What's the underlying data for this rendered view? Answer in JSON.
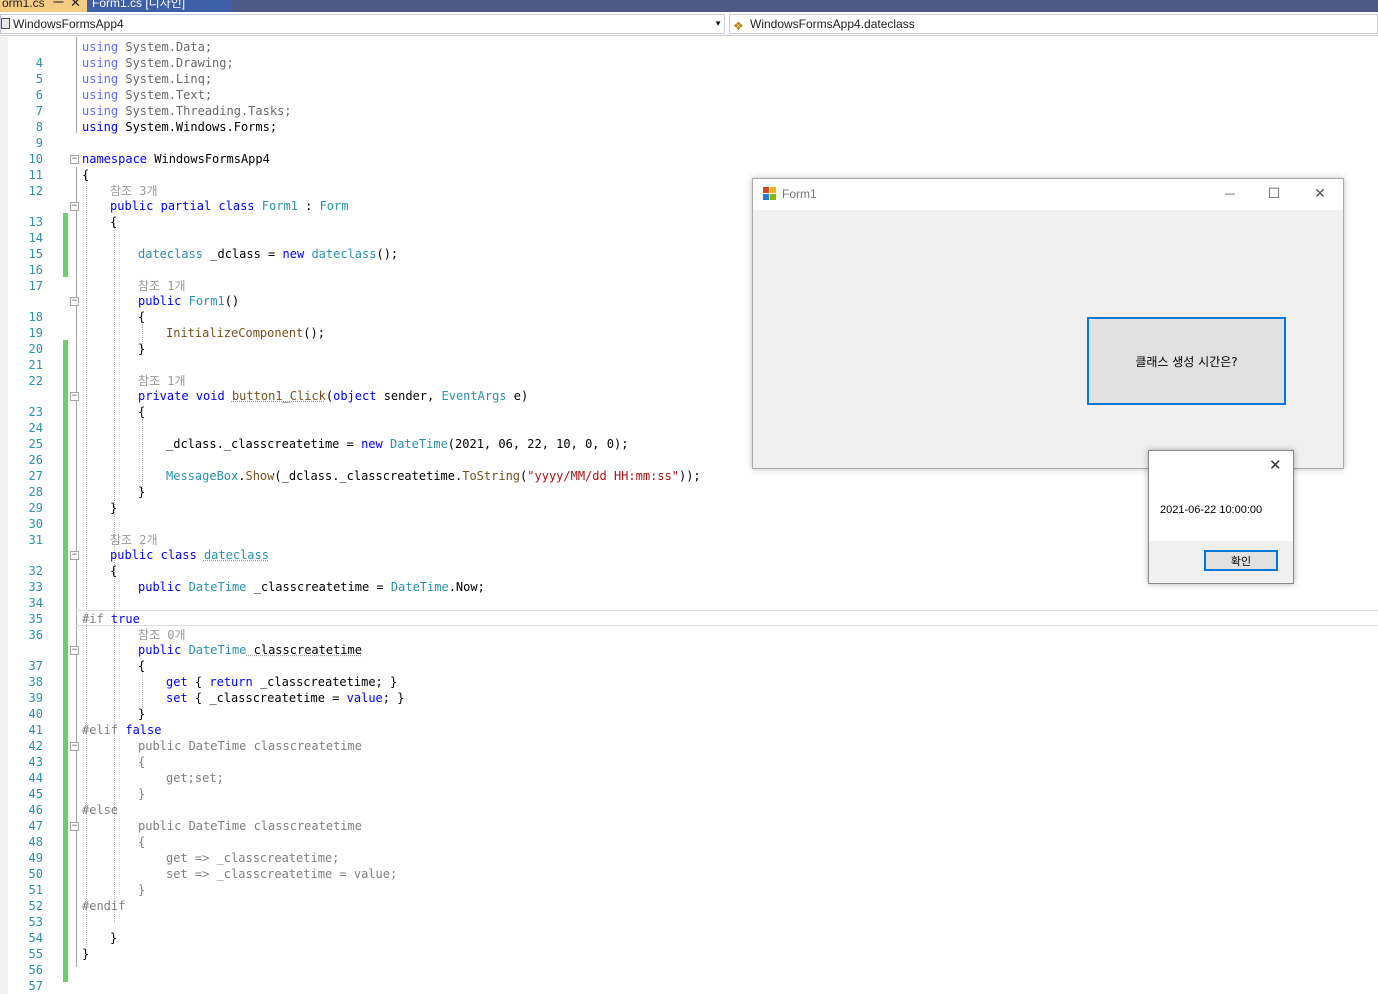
{
  "tabs": {
    "active": "orm1.cs",
    "active_pin": "㆒",
    "active_close": "✕",
    "inactive": "Form1.cs [디자인]"
  },
  "navbar": {
    "project": "WindowsFormsApp4",
    "member": "WindowsFormsApp4.dateclass"
  },
  "code": {
    "refs": {
      "r3": "참조 3개",
      "r1": "참조 1개",
      "r2": "참조 2개",
      "r0": "참조 0개"
    },
    "ln": [
      "4",
      "5",
      "6",
      "7",
      "8",
      "9",
      "10",
      "11",
      "12",
      "13",
      "14",
      "15",
      "16",
      "17",
      "18",
      "19",
      "20",
      "21",
      "22",
      "23",
      "24",
      "25",
      "26",
      "27",
      "28",
      "29",
      "30",
      "31",
      "32",
      "33",
      "34",
      "35",
      "36",
      "37",
      "38",
      "39",
      "40",
      "41",
      "42",
      "43",
      "44",
      "45",
      "46",
      "47",
      "48",
      "49",
      "50",
      "51",
      "52",
      "53",
      "54",
      "55",
      "56",
      "57"
    ],
    "t": {
      "using": "using",
      "ns_data": " System.Data;",
      "ns_drawing": " System.Drawing;",
      "ns_linq": " System.Linq;",
      "ns_text": " System.Text;",
      "ns_tasks": " System.Threading.Tasks;",
      "ns_forms": " System.Windows.Forms;",
      "namespace": "namespace",
      "ns_name": " WindowsFormsApp4",
      "open_brace": "{",
      "close_brace": "}",
      "public": "public",
      "partial": "partial",
      "class": "class",
      "private": "private",
      "void": "void",
      "new": "new",
      "get": "get",
      "set": "set",
      "return": "return",
      "value": "value",
      "true": "true",
      "false": "false",
      "object": "object",
      "sp": " ",
      "form1": "Form1",
      "colon": " : ",
      "form": "Form",
      "dateclass": "dateclass",
      "dclass_decl": " _dclass = ",
      "call_end": "();",
      "paren_pair": "()",
      "init": "InitializeComponent",
      "button1_click": "button1_Click",
      "paren_open": "(",
      "sender": " sender, ",
      "eventargs": "EventArgs",
      "e_close": " e)",
      "dclass_assign": "_dclass._classcreatetime = ",
      "datetime": "DateTime",
      "dt_args": "(2021, 06, 22, 10, 0, 0);",
      "messagebox": "MessageBox",
      "dot": ".",
      "show": "Show",
      "show_arg": "(_dclass._classcreatetime.",
      "tostring": "ToString",
      "format_str": "\"yyyy/MM/dd HH:mm:ss\"",
      "call_close": "));",
      "classcreatetime_field": " _classcreatetime = ",
      "now": "Now;",
      "classcreatetime": " classcreatetime",
      "get_body_open": " { ",
      "get_body_close": " _classcreatetime; }",
      "set_body_open": " { _classcreatetime = ",
      "set_body_close": "; }",
      "if": "#if ",
      "elif": "#elif ",
      "else": "#else",
      "endif": "#endif",
      "dim_prop": "public DateTime classcreatetime",
      "dim_open": "{",
      "dim_close": "}",
      "dim_getset": "get;set;",
      "dim_get_arrow": "get => _classcreatetime;",
      "dim_set_arrow": "set => _classcreatetime = value;"
    }
  },
  "form1": {
    "title": "Form1",
    "minimize": "—",
    "maximize": "☐",
    "close": "✕",
    "button_label": "클래스 생성 시간은?"
  },
  "msgbox": {
    "close": "✕",
    "text": "2021-06-22 10:00:00",
    "ok": "확인"
  }
}
